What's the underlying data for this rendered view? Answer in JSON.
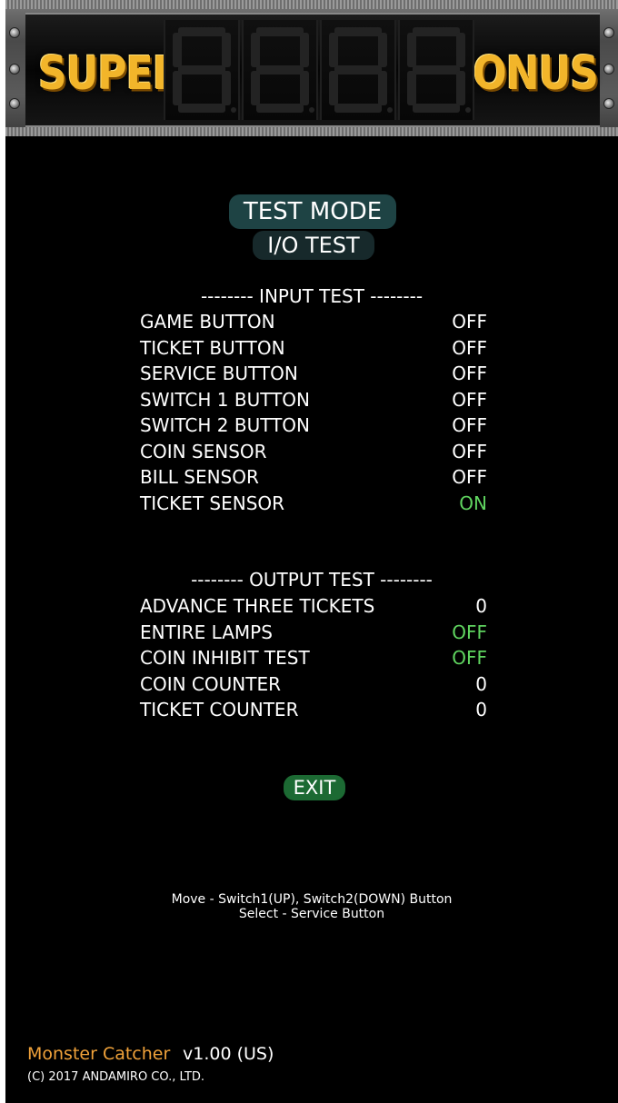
{
  "marquee": {
    "left_word": "SUPER",
    "right_word": "BONUS",
    "digit_display": "8.8.8.8."
  },
  "header": {
    "title": "TEST MODE",
    "subtitle": "I/O TEST"
  },
  "input_test": {
    "heading": "-------- INPUT TEST --------",
    "rows": [
      {
        "label": "GAME BUTTON",
        "value": "OFF",
        "status_color": "#ffffff"
      },
      {
        "label": "TICKET BUTTON",
        "value": "OFF",
        "status_color": "#ffffff"
      },
      {
        "label": "SERVICE BUTTON",
        "value": "OFF",
        "status_color": "#ffffff"
      },
      {
        "label": "SWITCH 1 BUTTON",
        "value": "OFF",
        "status_color": "#ffffff"
      },
      {
        "label": "SWITCH 2 BUTTON",
        "value": "OFF",
        "status_color": "#ffffff"
      },
      {
        "label": "COIN SENSOR",
        "value": "OFF",
        "status_color": "#ffffff"
      },
      {
        "label": "BILL SENSOR",
        "value": "OFF",
        "status_color": "#ffffff"
      },
      {
        "label": "TICKET SENSOR",
        "value": "ON",
        "status_color": "#5fd45f"
      }
    ]
  },
  "output_test": {
    "heading": "-------- OUTPUT TEST --------",
    "rows": [
      {
        "label": "ADVANCE THREE TICKETS",
        "value": "0",
        "status_color": "#ffffff"
      },
      {
        "label": "ENTIRE LAMPS",
        "value": "OFF",
        "status_color": "#5fd45f"
      },
      {
        "label": "COIN INHIBIT TEST",
        "value": "OFF",
        "status_color": "#5fd45f"
      },
      {
        "label": "COIN COUNTER",
        "value": "0",
        "status_color": "#ffffff"
      },
      {
        "label": "TICKET COUNTER",
        "value": "0",
        "status_color": "#ffffff"
      }
    ]
  },
  "exit_label": "EXIT",
  "hints": {
    "line1": "Move - Switch1(UP), Switch2(DOWN) Button",
    "line2": "Select - Service Button"
  },
  "footer": {
    "game_name": "Monster Catcher",
    "version": "v1.00 (US)",
    "copyright": "(C) 2017 ANDAMIRO CO., LTD."
  },
  "colors": {
    "background": "#000000",
    "title_pill": "#1e4344",
    "subtitle_pill": "#17292b",
    "exit_button": "#1c6a33",
    "status_on": "#5fd45f",
    "game_name": "#f0a23a",
    "marquee_gold": "#f2b52a"
  }
}
